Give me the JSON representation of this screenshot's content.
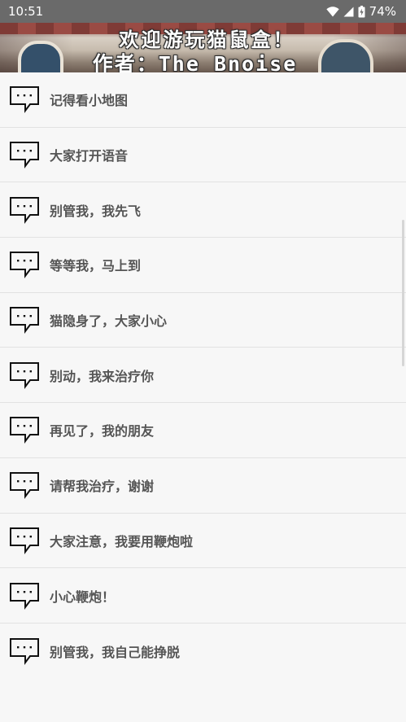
{
  "status_bar": {
    "time": "10:51",
    "battery": "74%"
  },
  "banner": {
    "title": "欢迎游玩猫鼠盒！",
    "author": "作者：The_Bnoise"
  },
  "list": {
    "items": [
      {
        "label": "记得看小地图",
        "icon": "message-icon"
      },
      {
        "label": "大家打开语音",
        "icon": "message-icon"
      },
      {
        "label": "别管我，我先飞",
        "icon": "message-icon"
      },
      {
        "label": "等等我，马上到",
        "icon": "message-icon"
      },
      {
        "label": "猫隐身了，大家小心",
        "icon": "message-icon"
      },
      {
        "label": "别动，我来治疗你",
        "icon": "message-icon"
      },
      {
        "label": "再见了，我的朋友",
        "icon": "message-icon"
      },
      {
        "label": "请帮我治疗，谢谢",
        "icon": "message-icon"
      },
      {
        "label": "大家注意，我要用鞭炮啦",
        "icon": "message-icon"
      },
      {
        "label": "小心鞭炮！",
        "icon": "message-icon"
      },
      {
        "label": "别管我，我自己能挣脱",
        "icon": "message-icon"
      }
    ]
  }
}
